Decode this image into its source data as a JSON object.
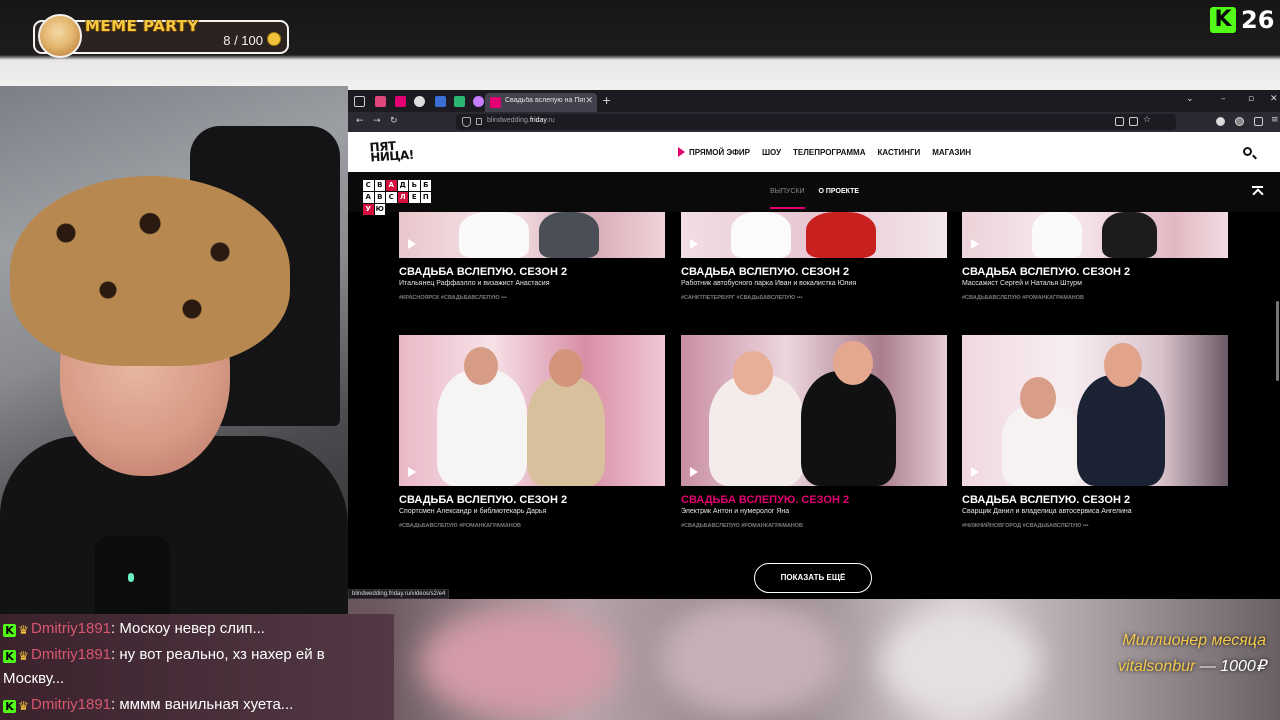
{
  "meme_widget": {
    "title": "MEME PARTY",
    "count": "8 / 100"
  },
  "kick": {
    "logo": "K",
    "count": "26"
  },
  "browser": {
    "tab_title": "Свадьба вслепую на Пятнице",
    "url_domain": "blindwedding.",
    "url_main": "friday",
    "url_tld": ".ru",
    "status_url": "blindwedding.friday.ru/videos/s2/e4"
  },
  "site": {
    "logo_line1": "ПЯТ",
    "logo_line2": "НИЦА!",
    "nav": [
      "ПРЯМОЙ ЭФИР",
      "ШОУ",
      "ТЕЛЕПРОГРАММА",
      "КАСТИНГИ",
      "МАГАЗИН"
    ],
    "show_logo_letters": [
      "С",
      "В",
      "А",
      "Д",
      "Ь",
      "Б",
      "А",
      "В",
      "С",
      "Л",
      "Е",
      "П",
      "У",
      "Ю"
    ],
    "subnav": [
      "ВЫПУСКИ",
      "О ПРОЕКТЕ"
    ],
    "more_button": "ПОКАЗАТЬ ЕЩЁ"
  },
  "episodes": [
    {
      "title": "СВАДЬБА ВСЛЕПУЮ. СЕЗОН 2",
      "desc": "Итальянец Раффаэлло и визажист Анастасия",
      "tags": "#КРАСНОЯРСК   #СВАДЬБАВСЛЕПУЮ   •••",
      "highlight": false
    },
    {
      "title": "СВАДЬБА ВСЛЕПУЮ. СЕЗОН 2",
      "desc": "Работник автобусного парка Иван и вокалистка Юлия",
      "tags": "#САНКТПЕТЕРБУРГ   #СВАДЬБАВСЛЕПУЮ   •••",
      "highlight": false
    },
    {
      "title": "СВАДЬБА ВСЛЕПУЮ. СЕЗОН 2",
      "desc": "Массажист Сергей и Наталья Штурм",
      "tags": "#СВАДЬБАВСЛЕПУЮ   #РОМАНКАГРАМАНОВ",
      "highlight": false
    },
    {
      "title": "СВАДЬБА ВСЛЕПУЮ. СЕЗОН 2",
      "desc": "Спортсмен Александр и библиотекарь Дарья",
      "tags": "#СВАДЬБАВСЛЕПУЮ   #РОМАНКАГРАМАНОВ",
      "highlight": false
    },
    {
      "title": "СВАДЬБА ВСЛЕПУЮ. СЕЗОН 2",
      "desc": "Электрик Антон и нумеролог Яна",
      "tags": "#СВАДЬБАВСЛЕПУЮ   #РОМАНКАГРАМАНОВ",
      "highlight": true
    },
    {
      "title": "СВАДЬБА ВСЛЕПУЮ. СЕЗОН 2",
      "desc": "Сварщик Данил и владелица автосервиса Ангелина",
      "tags": "#НИЖНИЙНОВГОРОД   #СВАДЬБАВСЛЕПУЮ   •••",
      "highlight": false
    }
  ],
  "chat": [
    {
      "user": "Dmitriy1891",
      "msg": ": Москоу невер слип..."
    },
    {
      "user": "Dmitriy1891",
      "msg": ": ну вот реально, хз нахер ей в"
    },
    {
      "user": "",
      "msg": "Москву..."
    },
    {
      "user": "Dmitriy1891",
      "msg": ": мммм ванильная хуета..."
    }
  ],
  "millionaire": {
    "title": "Миллионер месяца",
    "user": "vitalsonbur",
    "amount": " — 1000₽"
  },
  "colors": {
    "accent": "#e30073",
    "kick_green": "#53fc18",
    "gold": "#f2c94c"
  }
}
